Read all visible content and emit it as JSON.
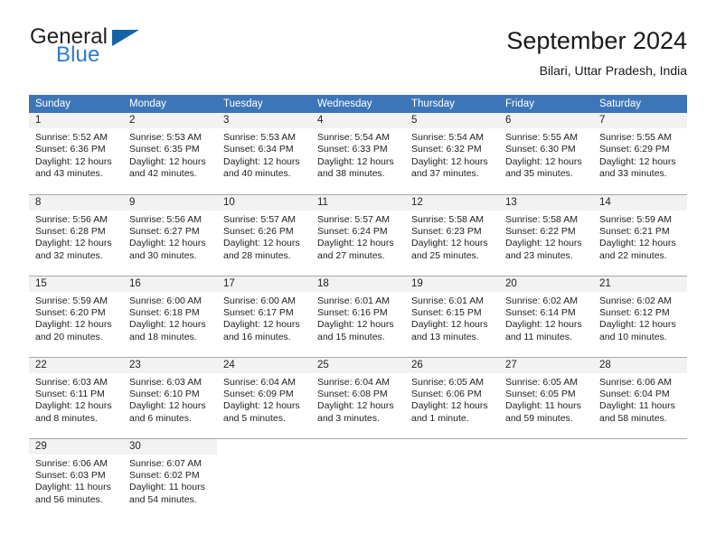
{
  "brand": {
    "name_top": "General",
    "name_bottom": "Blue",
    "triangle_icon": "triangle-icon",
    "color_dark": "#231f20",
    "color_blue": "#2d7dc4"
  },
  "header": {
    "title": "September 2024",
    "subtitle": "Bilari, Uttar Pradesh, India"
  },
  "calendar": {
    "header_bg": "#3d76b8",
    "header_text_color": "#ffffff",
    "daynum_bg": "#f2f2f2",
    "weekdays": [
      "Sunday",
      "Monday",
      "Tuesday",
      "Wednesday",
      "Thursday",
      "Friday",
      "Saturday"
    ],
    "weeks": [
      [
        {
          "day": "1",
          "sunrise": "Sunrise: 5:52 AM",
          "sunset": "Sunset: 6:36 PM",
          "daylight_line1": "Daylight: 12 hours",
          "daylight_line2": "and 43 minutes."
        },
        {
          "day": "2",
          "sunrise": "Sunrise: 5:53 AM",
          "sunset": "Sunset: 6:35 PM",
          "daylight_line1": "Daylight: 12 hours",
          "daylight_line2": "and 42 minutes."
        },
        {
          "day": "3",
          "sunrise": "Sunrise: 5:53 AM",
          "sunset": "Sunset: 6:34 PM",
          "daylight_line1": "Daylight: 12 hours",
          "daylight_line2": "and 40 minutes."
        },
        {
          "day": "4",
          "sunrise": "Sunrise: 5:54 AM",
          "sunset": "Sunset: 6:33 PM",
          "daylight_line1": "Daylight: 12 hours",
          "daylight_line2": "and 38 minutes."
        },
        {
          "day": "5",
          "sunrise": "Sunrise: 5:54 AM",
          "sunset": "Sunset: 6:32 PM",
          "daylight_line1": "Daylight: 12 hours",
          "daylight_line2": "and 37 minutes."
        },
        {
          "day": "6",
          "sunrise": "Sunrise: 5:55 AM",
          "sunset": "Sunset: 6:30 PM",
          "daylight_line1": "Daylight: 12 hours",
          "daylight_line2": "and 35 minutes."
        },
        {
          "day": "7",
          "sunrise": "Sunrise: 5:55 AM",
          "sunset": "Sunset: 6:29 PM",
          "daylight_line1": "Daylight: 12 hours",
          "daylight_line2": "and 33 minutes."
        }
      ],
      [
        {
          "day": "8",
          "sunrise": "Sunrise: 5:56 AM",
          "sunset": "Sunset: 6:28 PM",
          "daylight_line1": "Daylight: 12 hours",
          "daylight_line2": "and 32 minutes."
        },
        {
          "day": "9",
          "sunrise": "Sunrise: 5:56 AM",
          "sunset": "Sunset: 6:27 PM",
          "daylight_line1": "Daylight: 12 hours",
          "daylight_line2": "and 30 minutes."
        },
        {
          "day": "10",
          "sunrise": "Sunrise: 5:57 AM",
          "sunset": "Sunset: 6:26 PM",
          "daylight_line1": "Daylight: 12 hours",
          "daylight_line2": "and 28 minutes."
        },
        {
          "day": "11",
          "sunrise": "Sunrise: 5:57 AM",
          "sunset": "Sunset: 6:24 PM",
          "daylight_line1": "Daylight: 12 hours",
          "daylight_line2": "and 27 minutes."
        },
        {
          "day": "12",
          "sunrise": "Sunrise: 5:58 AM",
          "sunset": "Sunset: 6:23 PM",
          "daylight_line1": "Daylight: 12 hours",
          "daylight_line2": "and 25 minutes."
        },
        {
          "day": "13",
          "sunrise": "Sunrise: 5:58 AM",
          "sunset": "Sunset: 6:22 PM",
          "daylight_line1": "Daylight: 12 hours",
          "daylight_line2": "and 23 minutes."
        },
        {
          "day": "14",
          "sunrise": "Sunrise: 5:59 AM",
          "sunset": "Sunset: 6:21 PM",
          "daylight_line1": "Daylight: 12 hours",
          "daylight_line2": "and 22 minutes."
        }
      ],
      [
        {
          "day": "15",
          "sunrise": "Sunrise: 5:59 AM",
          "sunset": "Sunset: 6:20 PM",
          "daylight_line1": "Daylight: 12 hours",
          "daylight_line2": "and 20 minutes."
        },
        {
          "day": "16",
          "sunrise": "Sunrise: 6:00 AM",
          "sunset": "Sunset: 6:18 PM",
          "daylight_line1": "Daylight: 12 hours",
          "daylight_line2": "and 18 minutes."
        },
        {
          "day": "17",
          "sunrise": "Sunrise: 6:00 AM",
          "sunset": "Sunset: 6:17 PM",
          "daylight_line1": "Daylight: 12 hours",
          "daylight_line2": "and 16 minutes."
        },
        {
          "day": "18",
          "sunrise": "Sunrise: 6:01 AM",
          "sunset": "Sunset: 6:16 PM",
          "daylight_line1": "Daylight: 12 hours",
          "daylight_line2": "and 15 minutes."
        },
        {
          "day": "19",
          "sunrise": "Sunrise: 6:01 AM",
          "sunset": "Sunset: 6:15 PM",
          "daylight_line1": "Daylight: 12 hours",
          "daylight_line2": "and 13 minutes."
        },
        {
          "day": "20",
          "sunrise": "Sunrise: 6:02 AM",
          "sunset": "Sunset: 6:14 PM",
          "daylight_line1": "Daylight: 12 hours",
          "daylight_line2": "and 11 minutes."
        },
        {
          "day": "21",
          "sunrise": "Sunrise: 6:02 AM",
          "sunset": "Sunset: 6:12 PM",
          "daylight_line1": "Daylight: 12 hours",
          "daylight_line2": "and 10 minutes."
        }
      ],
      [
        {
          "day": "22",
          "sunrise": "Sunrise: 6:03 AM",
          "sunset": "Sunset: 6:11 PM",
          "daylight_line1": "Daylight: 12 hours",
          "daylight_line2": "and 8 minutes."
        },
        {
          "day": "23",
          "sunrise": "Sunrise: 6:03 AM",
          "sunset": "Sunset: 6:10 PM",
          "daylight_line1": "Daylight: 12 hours",
          "daylight_line2": "and 6 minutes."
        },
        {
          "day": "24",
          "sunrise": "Sunrise: 6:04 AM",
          "sunset": "Sunset: 6:09 PM",
          "daylight_line1": "Daylight: 12 hours",
          "daylight_line2": "and 5 minutes."
        },
        {
          "day": "25",
          "sunrise": "Sunrise: 6:04 AM",
          "sunset": "Sunset: 6:08 PM",
          "daylight_line1": "Daylight: 12 hours",
          "daylight_line2": "and 3 minutes."
        },
        {
          "day": "26",
          "sunrise": "Sunrise: 6:05 AM",
          "sunset": "Sunset: 6:06 PM",
          "daylight_line1": "Daylight: 12 hours",
          "daylight_line2": "and 1 minute."
        },
        {
          "day": "27",
          "sunrise": "Sunrise: 6:05 AM",
          "sunset": "Sunset: 6:05 PM",
          "daylight_line1": "Daylight: 11 hours",
          "daylight_line2": "and 59 minutes."
        },
        {
          "day": "28",
          "sunrise": "Sunrise: 6:06 AM",
          "sunset": "Sunset: 6:04 PM",
          "daylight_line1": "Daylight: 11 hours",
          "daylight_line2": "and 58 minutes."
        }
      ],
      [
        {
          "day": "29",
          "sunrise": "Sunrise: 6:06 AM",
          "sunset": "Sunset: 6:03 PM",
          "daylight_line1": "Daylight: 11 hours",
          "daylight_line2": "and 56 minutes."
        },
        {
          "day": "30",
          "sunrise": "Sunrise: 6:07 AM",
          "sunset": "Sunset: 6:02 PM",
          "daylight_line1": "Daylight: 11 hours",
          "daylight_line2": "and 54 minutes."
        },
        {
          "day": "",
          "sunrise": "",
          "sunset": "",
          "daylight_line1": "",
          "daylight_line2": ""
        },
        {
          "day": "",
          "sunrise": "",
          "sunset": "",
          "daylight_line1": "",
          "daylight_line2": ""
        },
        {
          "day": "",
          "sunrise": "",
          "sunset": "",
          "daylight_line1": "",
          "daylight_line2": ""
        },
        {
          "day": "",
          "sunrise": "",
          "sunset": "",
          "daylight_line1": "",
          "daylight_line2": ""
        },
        {
          "day": "",
          "sunrise": "",
          "sunset": "",
          "daylight_line1": "",
          "daylight_line2": ""
        }
      ]
    ]
  }
}
